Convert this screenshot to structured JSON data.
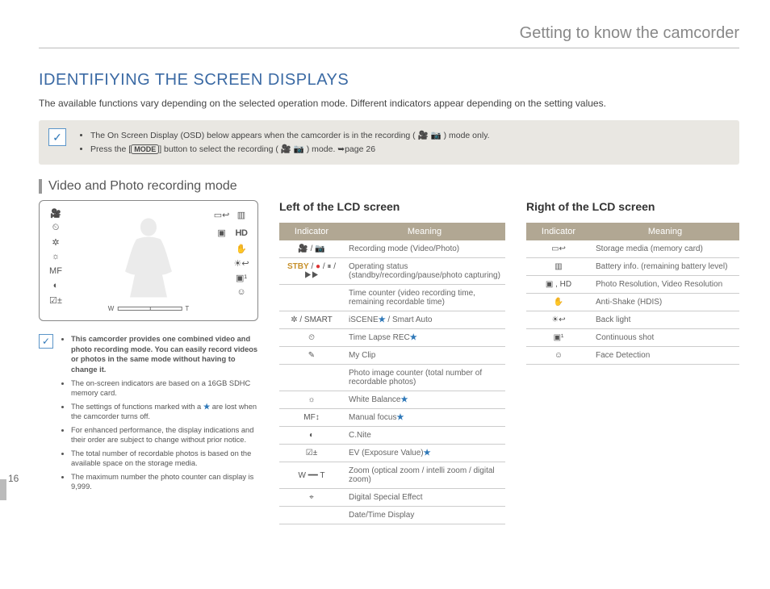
{
  "chapter": "Getting to know the camcorder",
  "title": "IDENTIFIYING THE SCREEN DISPLAYS",
  "intro": "The available functions vary depending on the selected operation mode. Different indicators appear depending on the setting values.",
  "topnote": {
    "items": [
      "The On Screen Display (OSD) below appears when the camcorder is in the recording ( 🎥 📷 ) mode only.",
      "Press the [MODE] button to select the recording ( 🎥 📷 ) mode. ➥page 26"
    ]
  },
  "subhead": "Video and Photo recording mode",
  "zoom": {
    "w": "W",
    "t": "T"
  },
  "smallnotes": [
    "This camcorder provides one combined video and photo recording mode. You can easily record videos or photos in the same mode without having to change it.",
    "The on-screen indicators are based on a 16GB SDHC memory card.",
    "The settings of functions marked with a ★ are lost when the camcorder turns off.",
    "For enhanced performance, the display indications and their order are subject to change without prior notice.",
    "The total number of recordable photos is based on the available space on the storage media.",
    "The maximum number the photo counter can display is 9,999."
  ],
  "pagenum": "16",
  "left_title": "Left of the LCD screen",
  "right_title": "Right of the LCD screen",
  "th_indicator": "Indicator",
  "th_meaning": "Meaning",
  "left_rows": [
    {
      "icon": "🎥 / 📷",
      "meaning": "Recording mode (Video/Photo)"
    },
    {
      "icon": "STBY / ● / ⏸ / ▶▶",
      "meaning": "Operating status (standby/recording/pause/photo capturing)"
    },
    {
      "icon": "",
      "meaning": "Time counter (video recording time, remaining recordable time)"
    },
    {
      "icon": "✲ / SMART",
      "meaning": "iSCENE★ / Smart Auto"
    },
    {
      "icon": "⏲",
      "meaning": "Time Lapse REC★"
    },
    {
      "icon": "✎",
      "meaning": "My Clip"
    },
    {
      "icon": "",
      "meaning": "Photo image counter (total number of recordable photos)"
    },
    {
      "icon": "☼",
      "meaning": "White Balance★"
    },
    {
      "icon": "MF↕",
      "meaning": "Manual focus★"
    },
    {
      "icon": "◐",
      "meaning": "C.Nite"
    },
    {
      "icon": "☑±",
      "meaning": "EV (Exposure Value)★"
    },
    {
      "icon": "W ━━ T",
      "meaning": "Zoom (optical zoom / intelli zoom / digital zoom)"
    },
    {
      "icon": "⌖",
      "meaning": "Digital Special Effect"
    },
    {
      "icon": "",
      "meaning": "Date/Time Display"
    }
  ],
  "right_rows": [
    {
      "icon": "▭↩",
      "meaning": "Storage media (memory card)"
    },
    {
      "icon": "▥",
      "meaning": "Battery info. (remaining battery level)"
    },
    {
      "icon": "▣ , HD",
      "meaning": "Photo Resolution, Video Resolution"
    },
    {
      "icon": "✋",
      "meaning": "Anti-Shake (HDIS)"
    },
    {
      "icon": "☀↩",
      "meaning": "Back light"
    },
    {
      "icon": "▣¹",
      "meaning": "Continuous shot"
    },
    {
      "icon": "☺",
      "meaning": "Face Detection"
    }
  ]
}
